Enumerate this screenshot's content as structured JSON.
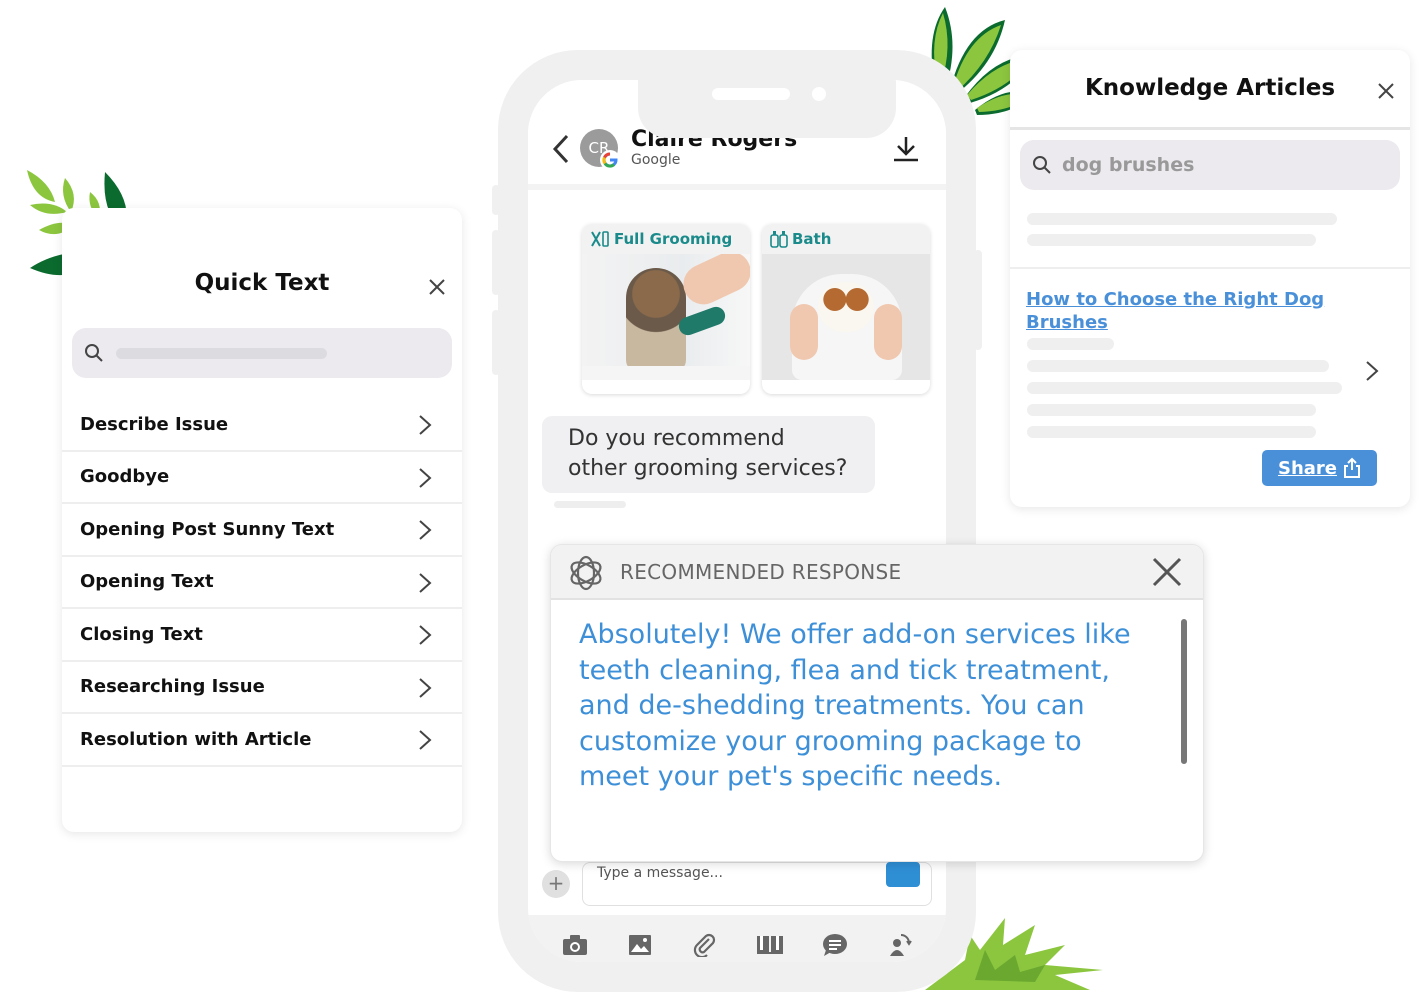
{
  "quick_text": {
    "title": "Quick Text",
    "close_icon": "close-icon",
    "search_placeholder": "",
    "items": [
      {
        "label": "Describe Issue"
      },
      {
        "label": "Goodbye"
      },
      {
        "label": "Opening Post Sunny Text"
      },
      {
        "label": "Opening Text"
      },
      {
        "label": "Closing Text"
      },
      {
        "label": "Researching Issue"
      },
      {
        "label": "Resolution with Article"
      }
    ]
  },
  "chat": {
    "contact": {
      "initials": "CR",
      "name": "Claire Rogers",
      "source": "Google"
    },
    "service_cards": [
      {
        "label": "Full Grooming",
        "icon": "grooming-tools-icon"
      },
      {
        "label": "Bath",
        "icon": "bath-bottles-icon"
      }
    ],
    "incoming_message": "Do you recommend other grooming services?",
    "composer": {
      "placeholder": "Type a message...",
      "add_label": "+"
    },
    "toolbar": [
      {
        "icon": "camera-icon"
      },
      {
        "icon": "image-icon"
      },
      {
        "icon": "paperclip-icon"
      },
      {
        "icon": "book-icon"
      },
      {
        "icon": "chat-bubble-icon"
      },
      {
        "icon": "transfer-agent-icon"
      }
    ]
  },
  "recommended_response": {
    "title": "RECOMMENDED RESPONSE",
    "body": "Absolutely! We offer add-on services like teeth cleaning, flea and tick treatment, and de-shedding treatments. You can customize your grooming package to meet your pet's specific needs."
  },
  "knowledge_articles": {
    "title": "Knowledge Articles",
    "search_value": "dog brushes",
    "article_title": "How to Choose the Right Dog Brushes",
    "share_label": "Share"
  },
  "colors": {
    "accent_blue": "#4a90d9",
    "response_blue": "#3d8fd8",
    "teal": "#1a8a8a",
    "leaf_green": "#8cc63f",
    "leaf_dark": "#0b6b2e"
  }
}
